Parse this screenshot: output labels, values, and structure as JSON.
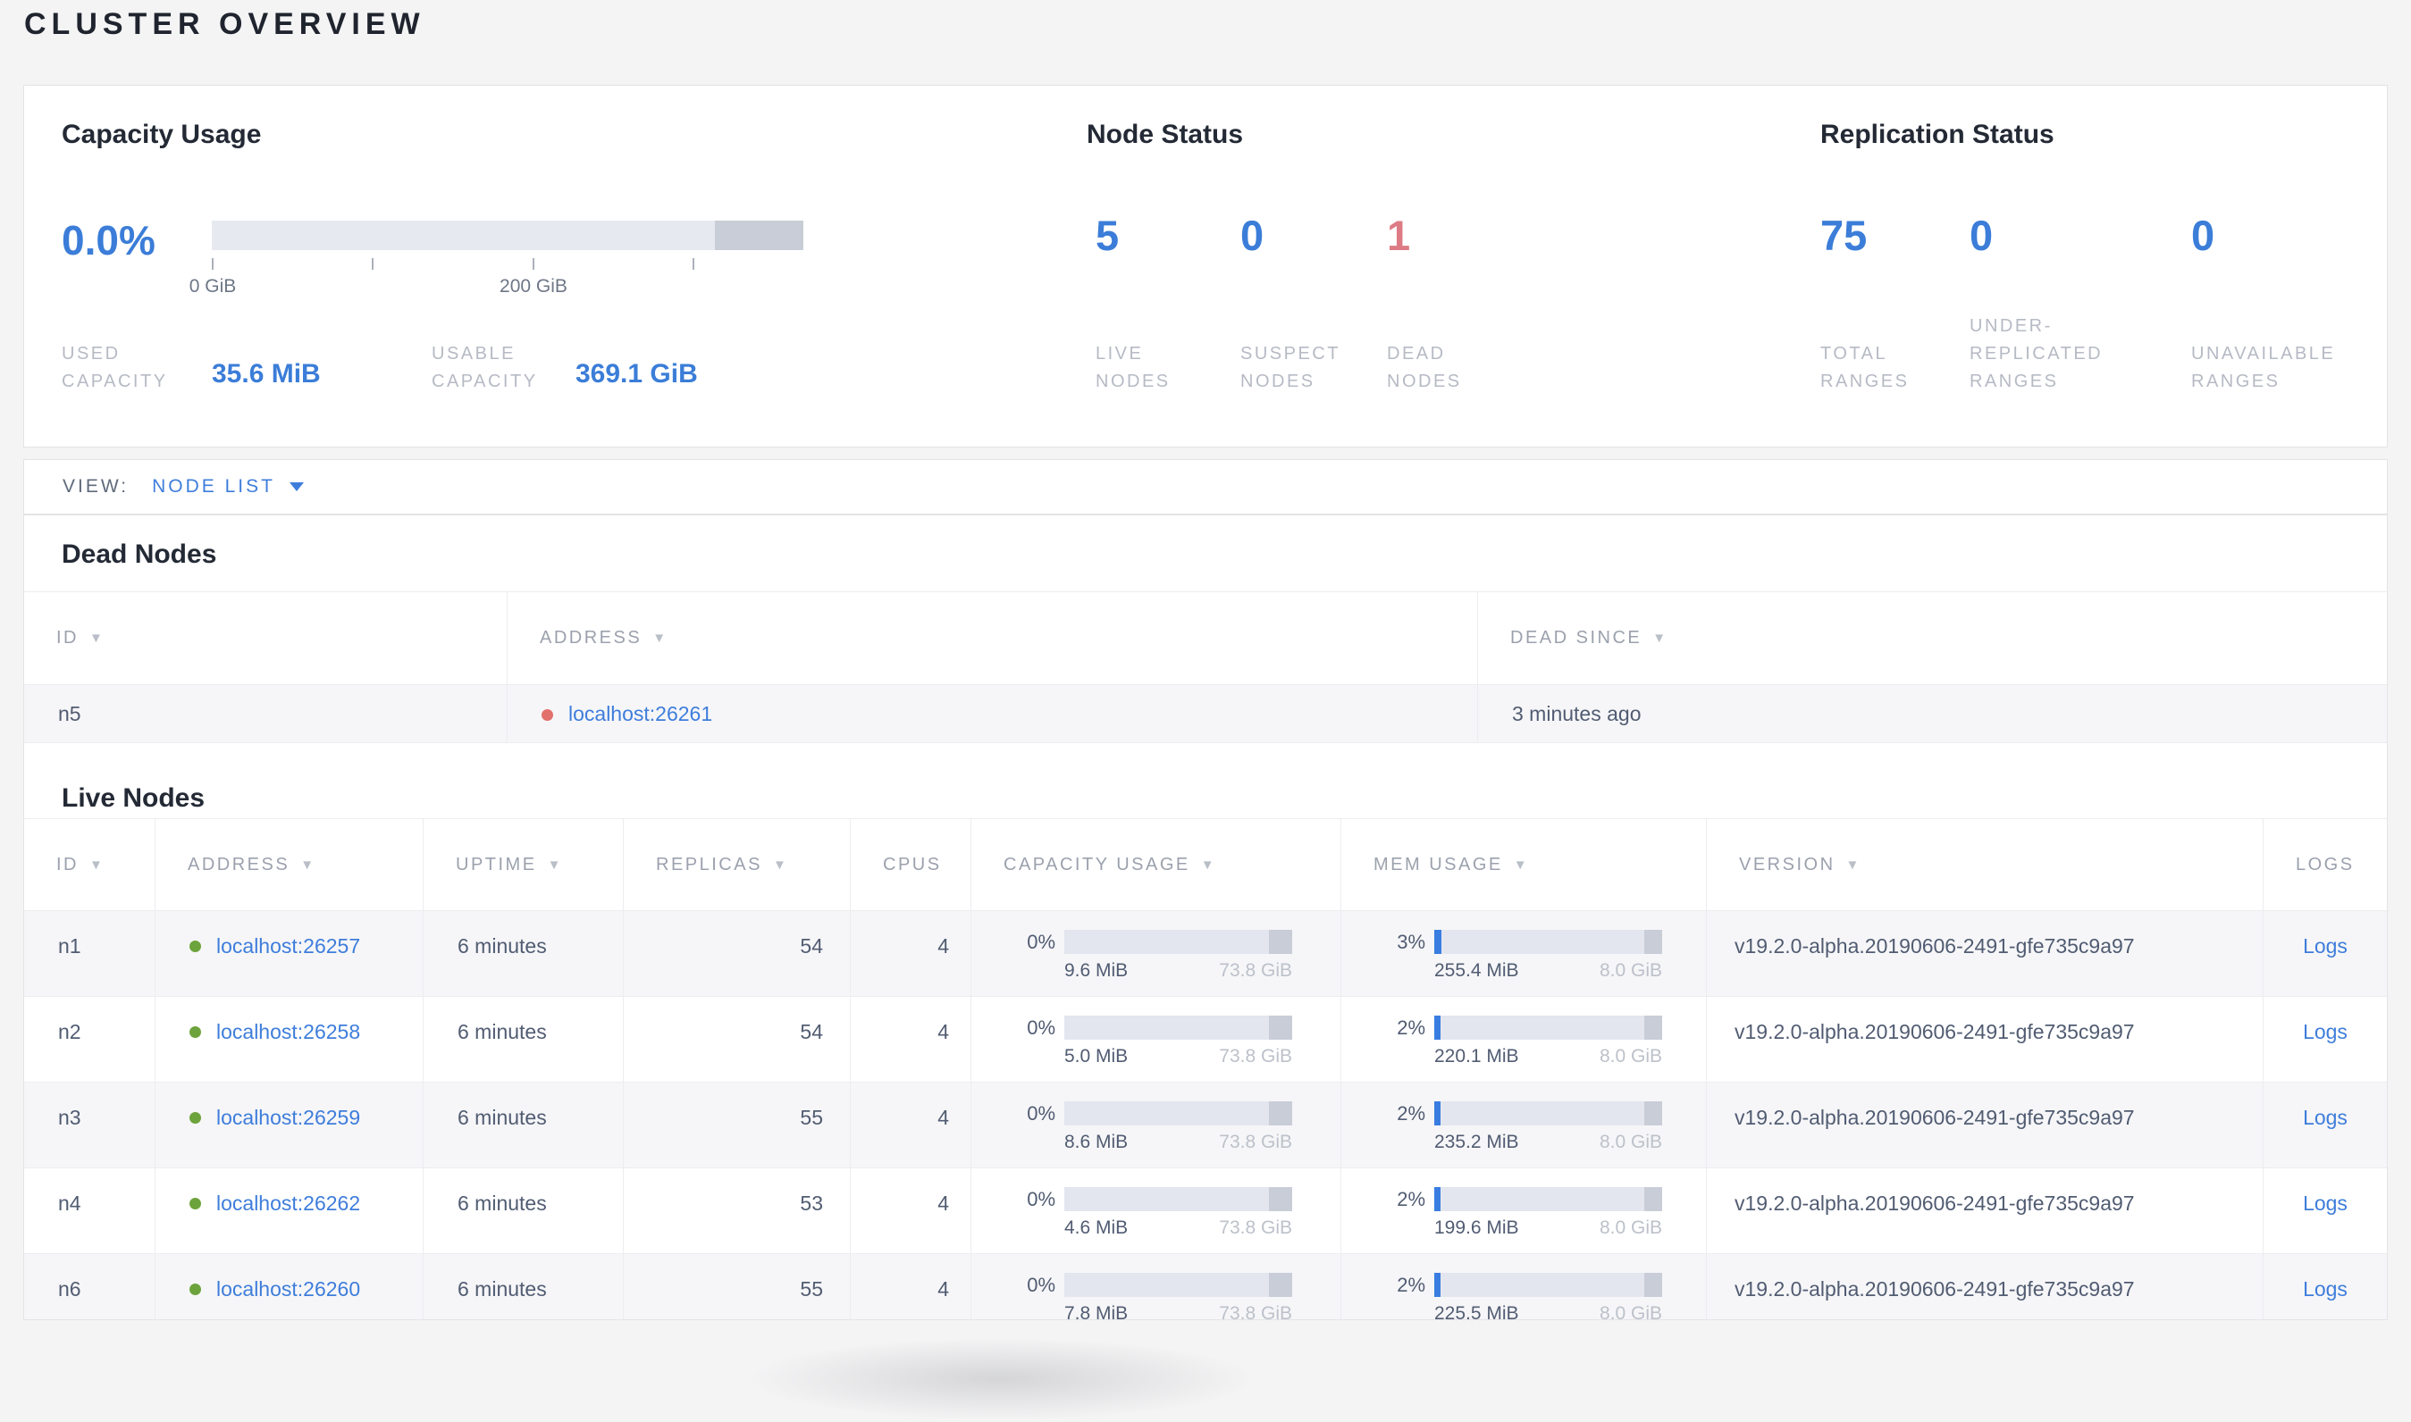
{
  "page": {
    "title": "CLUSTER OVERVIEW"
  },
  "colors": {
    "accent_blue": "#3b7dd8",
    "danger_red": "#dd7b85",
    "link_blue": "#3e7ddb",
    "live_dot_green": "#6da33c",
    "dead_dot_red": "#e2706c",
    "bar_track": "#e3e6ee",
    "bar_remainder": "#c9cdd8",
    "mem_fill_blue": "#3a7de1",
    "page_background": "#f4f4f5"
  },
  "icons": {
    "sort_arrow": "▼"
  },
  "summary": {
    "capacity": {
      "title": "Capacity Usage",
      "percent": "0.0%",
      "tick_label_0": "0 GiB",
      "tick_label_200": "200 GiB",
      "used": {
        "label_lines": [
          "USED",
          "CAPACITY"
        ],
        "value": "35.6 MiB"
      },
      "usable": {
        "label_lines": [
          "USABLE",
          "CAPACITY"
        ],
        "value": "369.1 GiB"
      }
    },
    "node_status": {
      "title": "Node Status",
      "stats": [
        {
          "value": "5",
          "label_lines": [
            "LIVE",
            "NODES"
          ]
        },
        {
          "value": "0",
          "label_lines": [
            "SUSPECT",
            "NODES"
          ]
        },
        {
          "value": "1",
          "label_lines": [
            "DEAD",
            "NODES"
          ]
        }
      ]
    },
    "replication": {
      "title": "Replication Status",
      "stats": [
        {
          "value": "75",
          "label_lines": [
            "TOTAL",
            "RANGES"
          ]
        },
        {
          "value": "0",
          "label_lines": [
            "UNDER-",
            "REPLICATED",
            "RANGES"
          ]
        },
        {
          "value": "0",
          "label_lines": [
            "UNAVAILABLE",
            "RANGES"
          ]
        }
      ]
    }
  },
  "view_bar": {
    "label": "VIEW:",
    "selected": "NODE LIST"
  },
  "dead_nodes": {
    "title": "Dead Nodes",
    "columns": {
      "id": "ID",
      "address": "ADDRESS",
      "dead_since": "DEAD SINCE"
    },
    "rows": [
      {
        "id": "n5",
        "address": "localhost:26261",
        "dead_since": "3 minutes ago"
      }
    ]
  },
  "live_nodes": {
    "title": "Live Nodes",
    "columns": {
      "id": "ID",
      "address": "ADDRESS",
      "uptime": "UPTIME",
      "replicas": "REPLICAS",
      "cpus": "CPUS",
      "capacity": "CAPACITY USAGE",
      "memory": "MEM USAGE",
      "version": "VERSION",
      "logs": "LOGS"
    },
    "rows": [
      {
        "id": "n1",
        "address": "localhost:26257",
        "uptime": "6 minutes",
        "replicas": "54",
        "cpus": "4",
        "capacity": {
          "percent": "0%",
          "used": "9.6 MiB",
          "total": "73.8 GiB"
        },
        "memory": {
          "percent": "3%",
          "used": "255.4 MiB",
          "total": "8.0 GiB"
        },
        "version": "v19.2.0-alpha.20190606-2491-gfe735c9a97",
        "logs_label": "Logs"
      },
      {
        "id": "n2",
        "address": "localhost:26258",
        "uptime": "6 minutes",
        "replicas": "54",
        "cpus": "4",
        "capacity": {
          "percent": "0%",
          "used": "5.0 MiB",
          "total": "73.8 GiB"
        },
        "memory": {
          "percent": "2%",
          "used": "220.1 MiB",
          "total": "8.0 GiB"
        },
        "version": "v19.2.0-alpha.20190606-2491-gfe735c9a97",
        "logs_label": "Logs"
      },
      {
        "id": "n3",
        "address": "localhost:26259",
        "uptime": "6 minutes",
        "replicas": "55",
        "cpus": "4",
        "capacity": {
          "percent": "0%",
          "used": "8.6 MiB",
          "total": "73.8 GiB"
        },
        "memory": {
          "percent": "2%",
          "used": "235.2 MiB",
          "total": "8.0 GiB"
        },
        "version": "v19.2.0-alpha.20190606-2491-gfe735c9a97",
        "logs_label": "Logs"
      },
      {
        "id": "n4",
        "address": "localhost:26262",
        "uptime": "6 minutes",
        "replicas": "53",
        "cpus": "4",
        "capacity": {
          "percent": "0%",
          "used": "4.6 MiB",
          "total": "73.8 GiB"
        },
        "memory": {
          "percent": "2%",
          "used": "199.6 MiB",
          "total": "8.0 GiB"
        },
        "version": "v19.2.0-alpha.20190606-2491-gfe735c9a97",
        "logs_label": "Logs"
      },
      {
        "id": "n6",
        "address": "localhost:26260",
        "uptime": "6 minutes",
        "replicas": "55",
        "cpus": "4",
        "capacity": {
          "percent": "0%",
          "used": "7.8 MiB",
          "total": "73.8 GiB"
        },
        "memory": {
          "percent": "2%",
          "used": "225.5 MiB",
          "total": "8.0 GiB"
        },
        "version": "v19.2.0-alpha.20190606-2491-gfe735c9a97",
        "logs_label": "Logs"
      }
    ]
  }
}
